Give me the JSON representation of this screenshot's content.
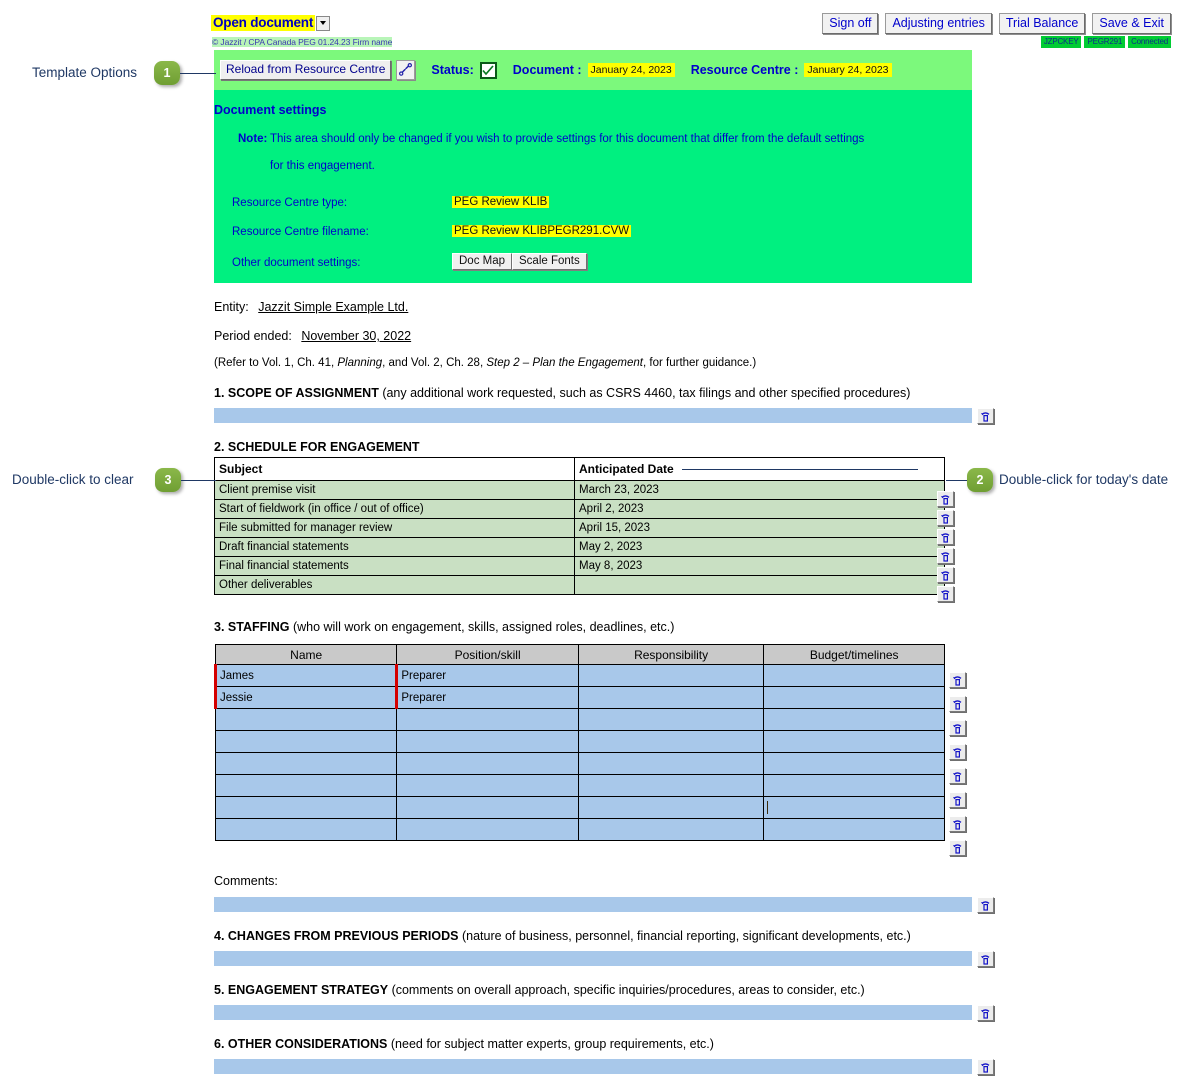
{
  "toolbar": {
    "open_document": "Open document",
    "dropdown_icon": "chevron-down-icon",
    "copyright": "© Jazzit / CPA Canada PEG 01.24.23 Firm name",
    "buttons": [
      {
        "label": "Sign off",
        "name": "sign-off-button"
      },
      {
        "label": "Adjusting entries",
        "name": "adjusting-entries-button"
      },
      {
        "label": "Trial Balance",
        "name": "trial-balance-button"
      },
      {
        "label": "Save & Exit",
        "name": "save-exit-button"
      }
    ],
    "badges": [
      "JZPCKEY",
      "PEGR291",
      "Connected"
    ]
  },
  "green_band": {
    "reload_label": "Reload from Resource Centre",
    "link_icon": "chain-link-icon",
    "status_label": "Status:",
    "status_checked": true,
    "document_label": "Document :",
    "document_date": "January 24, 2023",
    "resource_centre_label": "Resource Centre :",
    "resource_centre_date": "January 24, 2023"
  },
  "document_settings": {
    "title": "Document settings",
    "note_key": "Note:",
    "note_line1": "This area should only be changed if you wish to provide settings for this document that differ from the default settings",
    "note_line2": "for this engagement.",
    "rc_type_label": "Resource Centre type:",
    "rc_type_value": "PEG Review KLIB",
    "rc_file_label": "Resource Centre filename:",
    "rc_file_value": "PEG Review KLIBPEGR291.CVW",
    "other_label": "Other document settings:",
    "doc_map_button": "Doc Map",
    "scale_fonts_button": "Scale Fonts"
  },
  "meta": {
    "entity_label": "Entity:",
    "entity_value": "Jazzit Simple Example Ltd.",
    "period_label": "Period ended:",
    "period_value": "November 30, 2022",
    "guidance_a": "(Refer to Vol. 1, Ch. 41, ",
    "guidance_i1": "Planning",
    "guidance_b": ", and Vol. 2, Ch. 28, ",
    "guidance_i2": "Step 2 – Plan the Engagement",
    "guidance_c": ", for further guidance.)"
  },
  "sections": {
    "s1_num": "1. SCOPE OF ASSIGNMENT",
    "s1_sub": " (any additional work requested, such as CSRS 4460, tax filings and other specified procedures)",
    "s1_value": "",
    "s2_num": "2. SCHEDULE FOR ENGAGEMENT",
    "s3_num": "3. STAFFING",
    "s3_sub": " (who will work on engagement, skills, assigned roles, deadlines, etc.)",
    "comments_label": "Comments:",
    "comments_value": "",
    "s4_num": "4. CHANGES FROM PREVIOUS PERIODS",
    "s4_sub": " (nature of business, personnel, financial reporting, significant developments, etc.)",
    "s4_value": "",
    "s5_num": "5. ENGAGEMENT STRATEGY",
    "s5_sub": " (comments on overall approach, specific inquiries/procedures, areas to consider, etc.)",
    "s5_value": "",
    "s6_num": "6. OTHER CONSIDERATIONS",
    "s6_sub": " (need for subject matter experts, group requirements, etc.)",
    "s6_value": ""
  },
  "schedule_table": {
    "columns": [
      "Subject",
      "Anticipated Date"
    ],
    "rows": [
      {
        "subject": "Client premise visit",
        "date": "March 23, 2023"
      },
      {
        "subject": "Start of fieldwork (in office / out of office)",
        "date": "April 2, 2023"
      },
      {
        "subject": "File submitted for manager review",
        "date": "April 15, 2023"
      },
      {
        "subject": "Draft financial statements",
        "date": "May 2, 2023"
      },
      {
        "subject": "Final financial statements",
        "date": "May 8, 2023"
      },
      {
        "subject": "Other deliverables",
        "date": ""
      }
    ]
  },
  "staffing_table": {
    "columns": [
      "Name",
      "Position/skill",
      "Responsibility",
      "Budget/timelines"
    ],
    "rows": [
      {
        "name": "James",
        "position": "Preparer",
        "responsibility": "",
        "budget": ""
      },
      {
        "name": "Jessie",
        "position": "Preparer",
        "responsibility": "",
        "budget": ""
      },
      {
        "name": "",
        "position": "",
        "responsibility": "",
        "budget": ""
      },
      {
        "name": "",
        "position": "",
        "responsibility": "",
        "budget": ""
      },
      {
        "name": "",
        "position": "",
        "responsibility": "",
        "budget": ""
      },
      {
        "name": "",
        "position": "",
        "responsibility": "",
        "budget": ""
      },
      {
        "name": "",
        "position": "",
        "responsibility": "",
        "budget": ""
      },
      {
        "name": "",
        "position": "",
        "responsibility": "",
        "budget": ""
      }
    ]
  },
  "callouts": [
    {
      "number": "1",
      "text": "Template Options"
    },
    {
      "number": "2",
      "text": "Double-click for today's date"
    },
    {
      "number": "3",
      "text": "Double-click to clear"
    }
  ]
}
